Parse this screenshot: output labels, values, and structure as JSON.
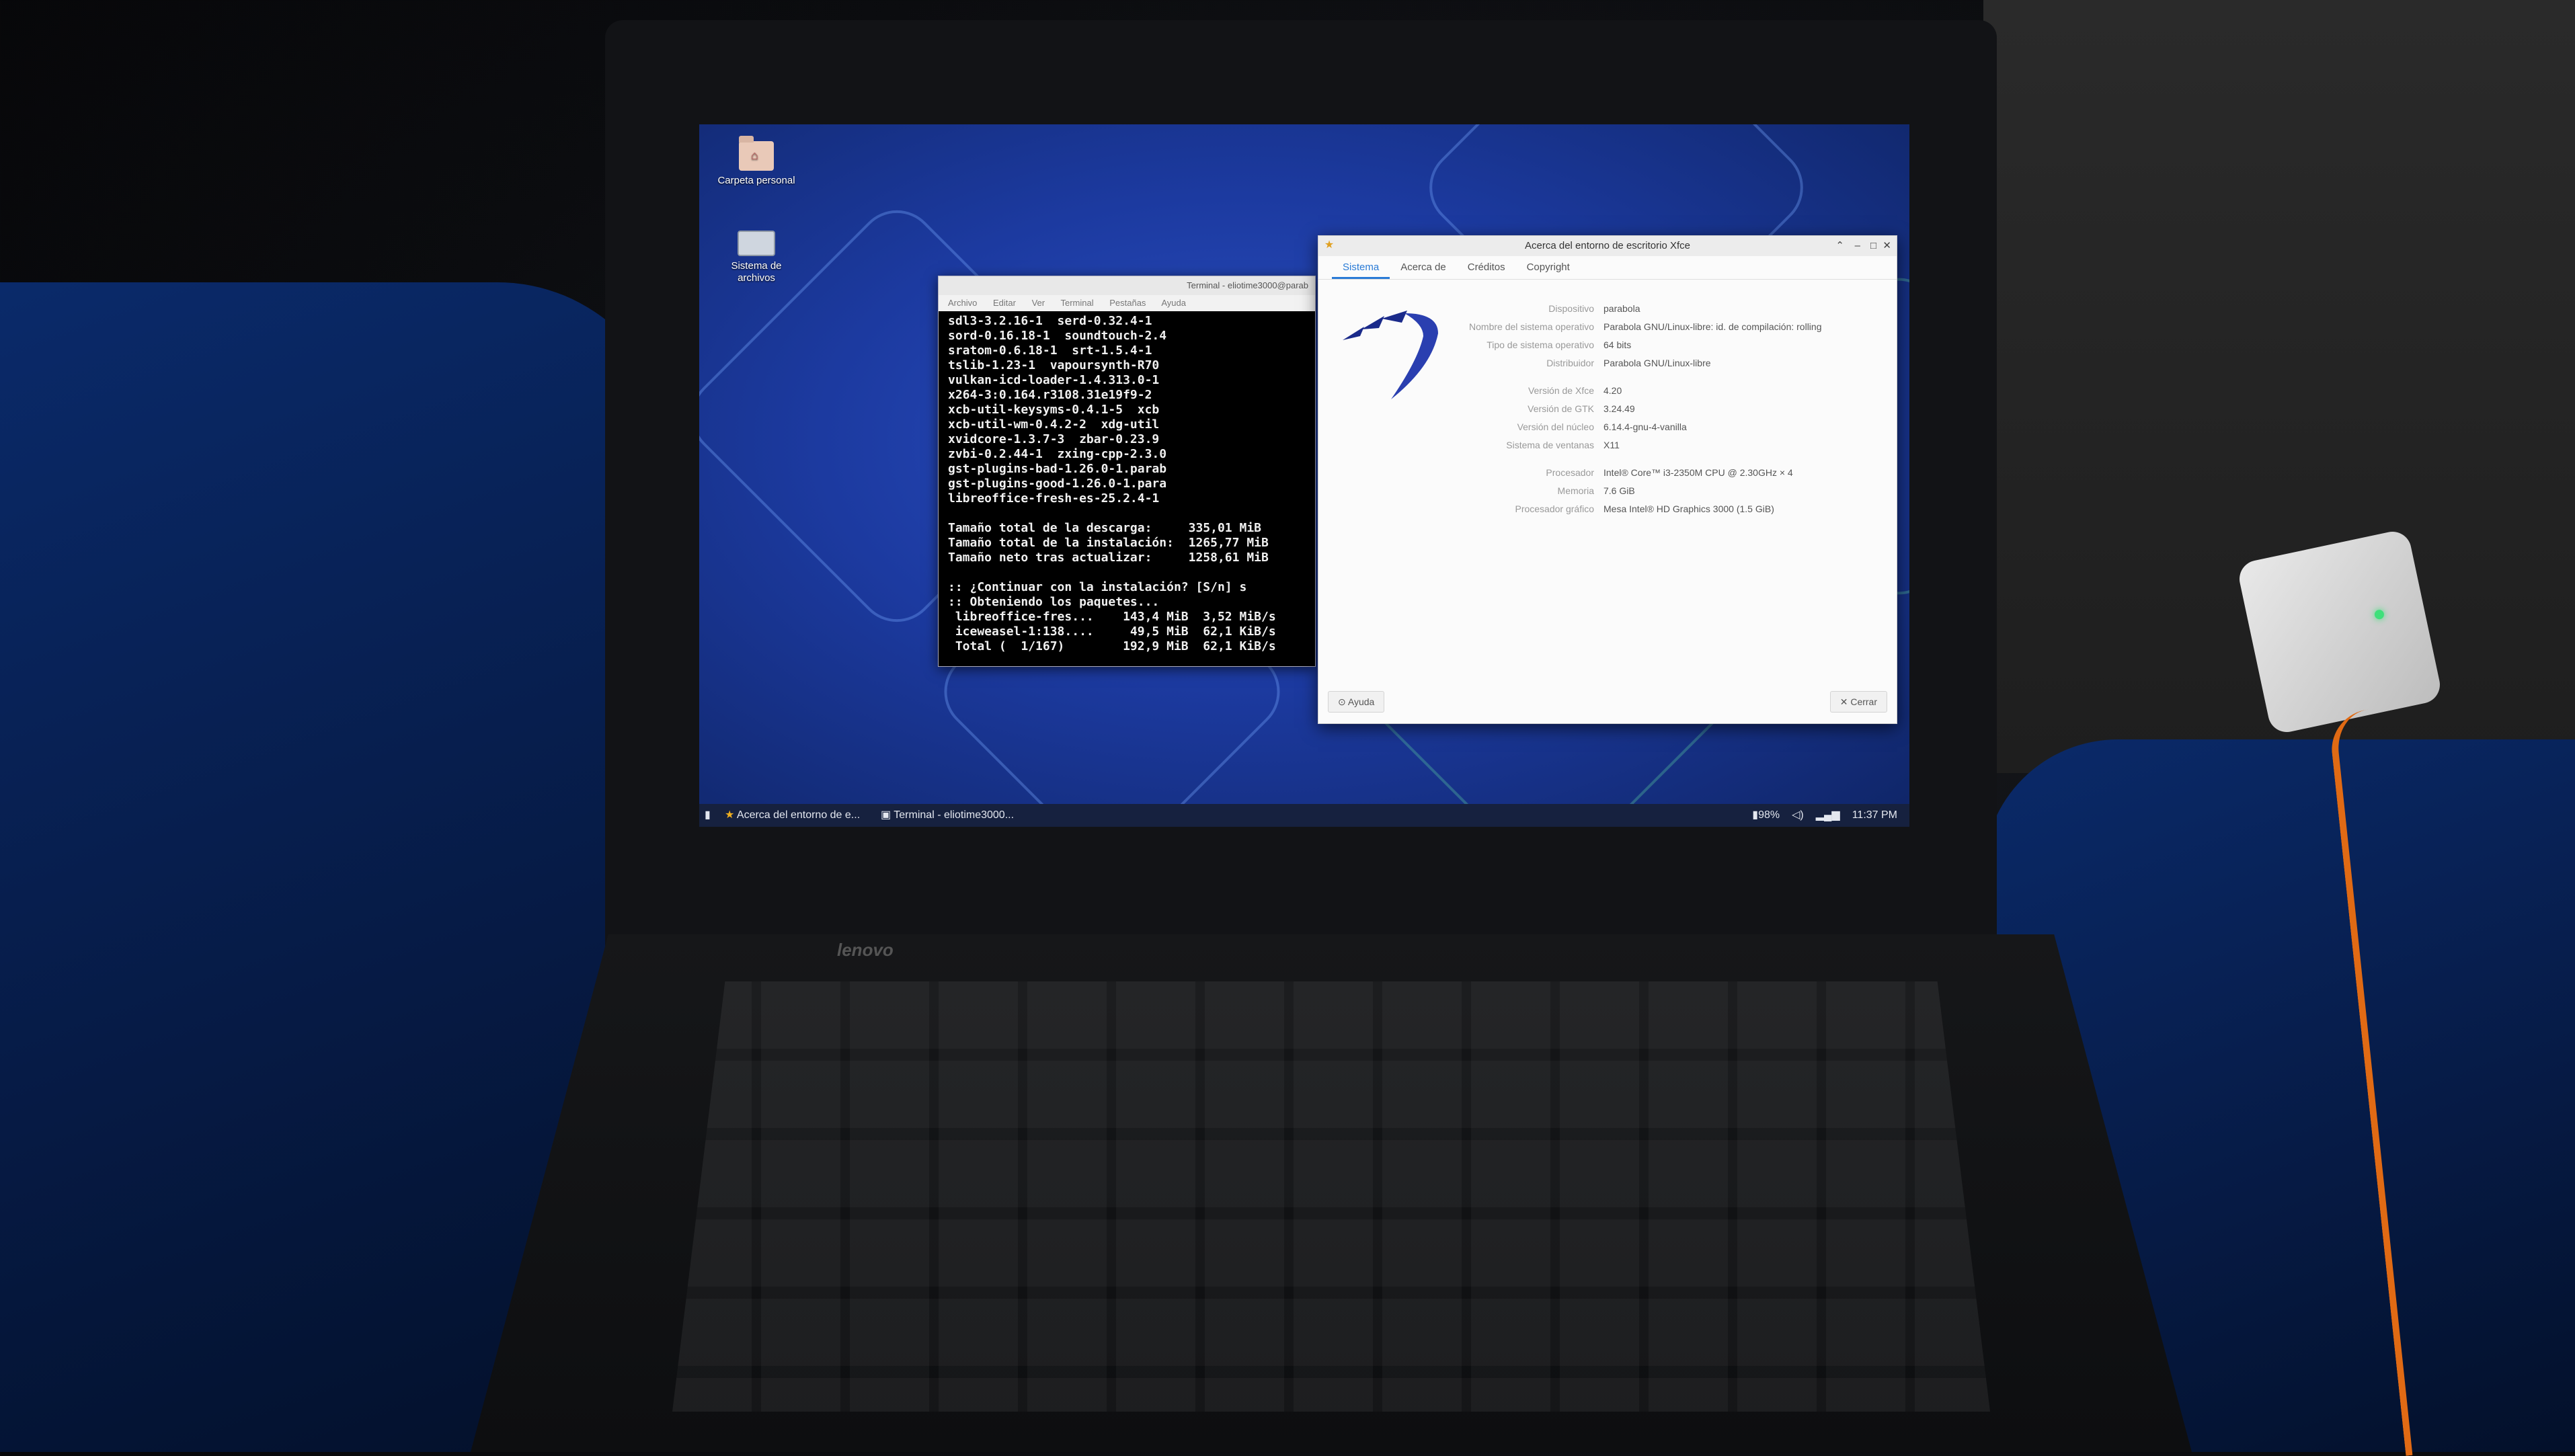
{
  "desktop": {
    "icons": [
      {
        "label": "Carpeta personal",
        "icon": "home-folder-icon"
      },
      {
        "label": "Sistema de archivos",
        "icon": "drive-icon"
      }
    ]
  },
  "terminal": {
    "title": "Terminal - eliotime3000@parab",
    "menu": [
      "Archivo",
      "Editar",
      "Ver",
      "Terminal",
      "Pestañas",
      "Ayuda"
    ],
    "lines": [
      "sdl3-3.2.16-1  serd-0.32.4-1",
      "sord-0.16.18-1  soundtouch-2.4",
      "sratom-0.6.18-1  srt-1.5.4-1",
      "tslib-1.23-1  vapoursynth-R70",
      "vulkan-icd-loader-1.4.313.0-1",
      "x264-3:0.164.r3108.31e19f9-2",
      "xcb-util-keysyms-0.4.1-5  xcb",
      "xcb-util-wm-0.4.2-2  xdg-util",
      "xvidcore-1.3.7-3  zbar-0.23.9",
      "zvbi-0.2.44-1  zxing-cpp-2.3.0",
      "gst-plugins-bad-1.26.0-1.parab",
      "gst-plugins-good-1.26.0-1.para",
      "libreoffice-fresh-es-25.2.4-1",
      "",
      "Tamaño total de la descarga:     335,01 MiB",
      "Tamaño total de la instalación:  1265,77 MiB",
      "Tamaño neto tras actualizar:     1258,61 MiB",
      "",
      ":: ¿Continuar con la instalación? [S/n] s",
      ":: Obteniendo los paquetes...",
      " libreoffice-fres...    143,4 MiB  3,52 MiB/s",
      " iceweasel-1:138....     49,5 MiB  62,1 KiB/s",
      " Total (  1/167)        192,9 MiB  62,1 KiB/s"
    ]
  },
  "about": {
    "title": "Acerca del entorno de escritorio Xfce",
    "tabs": [
      "Sistema",
      "Acerca de",
      "Créditos",
      "Copyright"
    ],
    "active_tab": "Sistema",
    "rows": [
      {
        "k": "Dispositivo",
        "v": "parabola"
      },
      {
        "k": "Nombre del sistema operativo",
        "v": "Parabola GNU/Linux-libre: id. de compilación: rolling"
      },
      {
        "k": "Tipo de sistema operativo",
        "v": "64 bits"
      },
      {
        "k": "Distribuidor",
        "v": "Parabola GNU/Linux-libre"
      },
      {
        "k": "Versión de Xfce",
        "v": "4.20"
      },
      {
        "k": "Versión de GTK",
        "v": "3.24.49"
      },
      {
        "k": "Versión del núcleo",
        "v": "6.14.4-gnu-4-vanilla"
      },
      {
        "k": "Sistema de ventanas",
        "v": "X11"
      },
      {
        "k": "Procesador",
        "v": "Intel® Core™ i3-2350M CPU @ 2.30GHz × 4"
      },
      {
        "k": "Memoria",
        "v": "7.6 GiB"
      },
      {
        "k": "Procesador gráfico",
        "v": "Mesa Intel® HD Graphics 3000 (1.5 GiB)"
      }
    ],
    "help_label": "Ayuda",
    "close_label": "Cerrar"
  },
  "panel": {
    "tasks": [
      "Acerca del entorno de e...",
      "Terminal - eliotime3000..."
    ],
    "battery": "98%",
    "clock": "11:37 PM"
  },
  "hardware": {
    "brand": "lenovo"
  },
  "colors": {
    "accent": "#2a7bd6",
    "wallpaper": "#1c3aa0",
    "panel": "#16213f"
  }
}
